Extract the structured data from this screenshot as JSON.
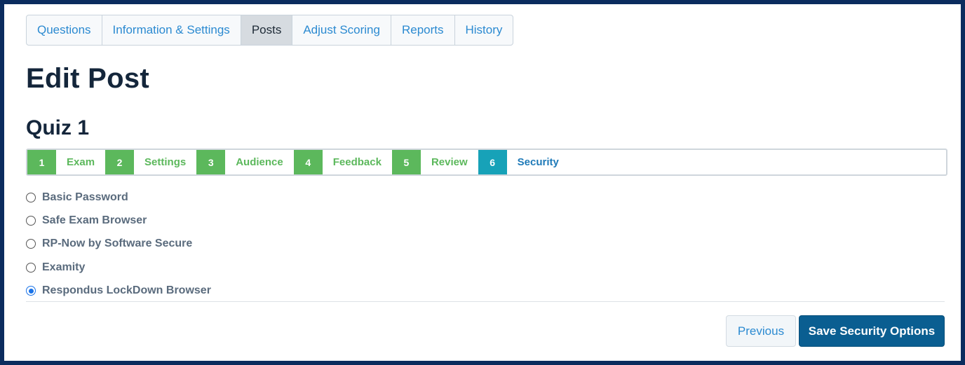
{
  "tabs": [
    {
      "label": "Questions"
    },
    {
      "label": "Information & Settings"
    },
    {
      "label": "Posts",
      "active": true
    },
    {
      "label": "Adjust Scoring"
    },
    {
      "label": "Reports"
    },
    {
      "label": "History"
    }
  ],
  "page_title": "Edit Post",
  "quiz_title": "Quiz 1",
  "steps": [
    {
      "num": "1",
      "label": "Exam"
    },
    {
      "num": "2",
      "label": "Settings"
    },
    {
      "num": "3",
      "label": "Audience"
    },
    {
      "num": "4",
      "label": "Feedback"
    },
    {
      "num": "5",
      "label": "Review"
    },
    {
      "num": "6",
      "label": "Security",
      "current": true
    }
  ],
  "security_options": [
    {
      "label": "Basic Password",
      "selected": false
    },
    {
      "label": "Safe Exam Browser",
      "selected": false
    },
    {
      "label": "RP-Now by Software Secure",
      "selected": false
    },
    {
      "label": "Examity",
      "selected": false
    },
    {
      "label": "Respondus LockDown Browser",
      "selected": true
    }
  ],
  "buttons": {
    "previous": "Previous",
    "save": "Save Security Options"
  },
  "colors": {
    "step_complete": "#5cb85c",
    "step_current": "#17a2b8",
    "primary_button": "#0a5e91",
    "link": "#2b8ad1"
  }
}
